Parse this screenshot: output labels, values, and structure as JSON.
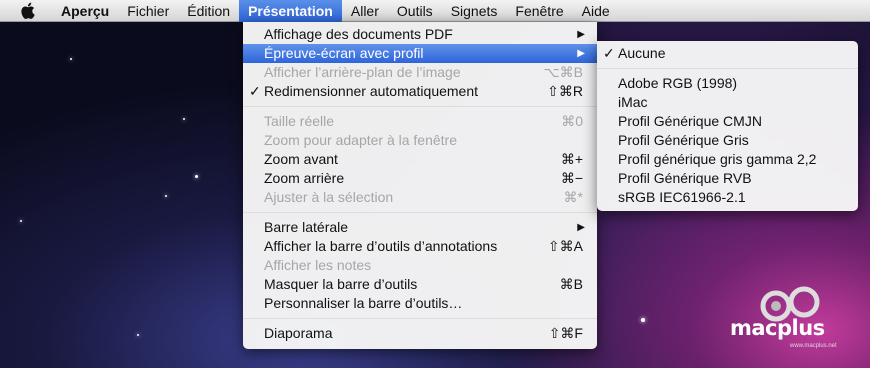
{
  "menubar": {
    "apple_icon": "apple-logo-icon",
    "items": [
      {
        "label": "Aperçu",
        "bold": true
      },
      {
        "label": "Fichier"
      },
      {
        "label": "Édition"
      },
      {
        "label": "Présentation",
        "active": true
      },
      {
        "label": "Aller"
      },
      {
        "label": "Outils"
      },
      {
        "label": "Signets"
      },
      {
        "label": "Fenêtre"
      },
      {
        "label": "Aide"
      }
    ]
  },
  "presentation_menu": {
    "items": [
      {
        "label": "Affichage des documents PDF",
        "submenu": true
      },
      {
        "label": "Épreuve-écran avec profil",
        "submenu": true,
        "highlighted": true
      },
      {
        "label": "Afficher l’arrière-plan de l’image",
        "shortcut": "⌥⌘B",
        "disabled": true
      },
      {
        "label": "Redimensionner automatiquement",
        "shortcut": "⇧⌘R",
        "checked": true
      },
      {
        "label": "Taille réelle",
        "shortcut": "⌘0",
        "disabled": true
      },
      {
        "label": "Zoom pour adapter à la fenêtre",
        "disabled": true
      },
      {
        "label": "Zoom avant",
        "shortcut": "⌘+"
      },
      {
        "label": "Zoom arrière",
        "shortcut": "⌘−"
      },
      {
        "label": "Ajuster à la sélection",
        "shortcut": "⌘*",
        "disabled": true
      },
      {
        "label": "Barre latérale",
        "submenu": true
      },
      {
        "label": "Afficher la barre d’outils d’annotations",
        "shortcut": "⇧⌘A"
      },
      {
        "label": "Afficher les notes",
        "disabled": true
      },
      {
        "label": "Masquer la barre d’outils",
        "shortcut": "⌘B"
      },
      {
        "label": "Personnaliser la barre d’outils…"
      },
      {
        "label": "Diaporama",
        "shortcut": "⇧⌘F"
      }
    ]
  },
  "profile_submenu": {
    "items": [
      {
        "label": "Aucune",
        "checked": true
      },
      {
        "label": "Adobe RGB (1998)"
      },
      {
        "label": "iMac"
      },
      {
        "label": "Profil Générique CMJN"
      },
      {
        "label": "Profil Générique Gris"
      },
      {
        "label": "Profil générique gris gamma 2,2"
      },
      {
        "label": "Profil Générique RVB"
      },
      {
        "label": "sRGB IEC61966-2.1"
      }
    ]
  },
  "glyphs": {
    "check": "✓",
    "submenu_arrow": "▶"
  },
  "watermark": {
    "text": "macplus",
    "sub": "www.macplus.net",
    "icon": "macplus-logo-icon"
  },
  "colors": {
    "highlight": "#2e65da",
    "disabled": "#a6a6a6"
  }
}
